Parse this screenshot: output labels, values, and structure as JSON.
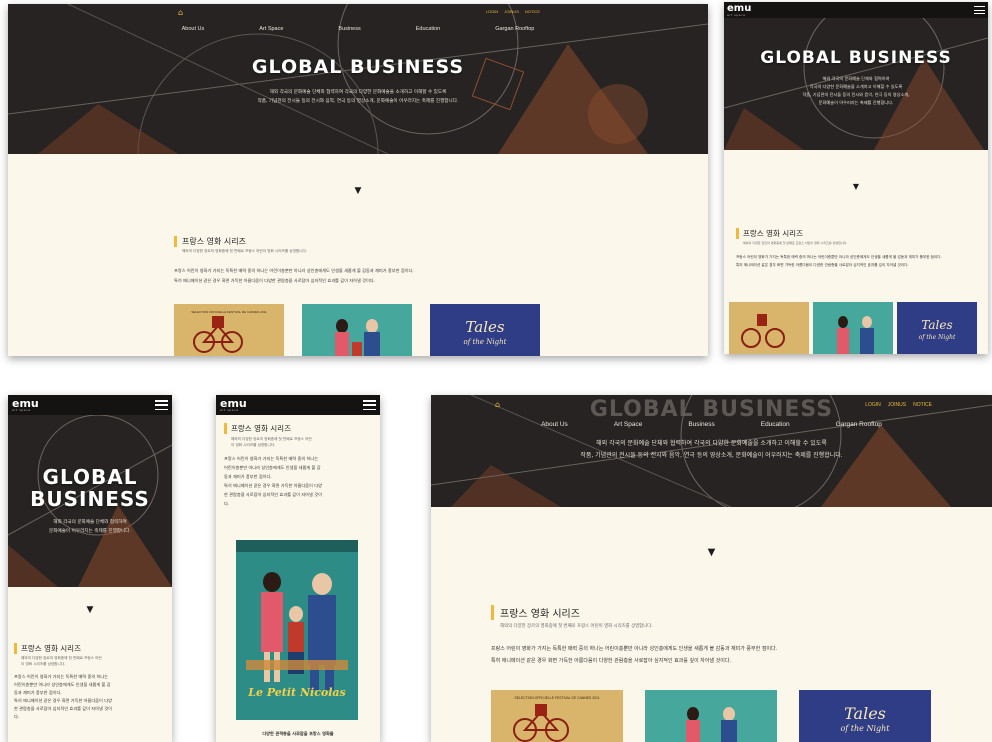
{
  "nav": {
    "items": [
      "About Us",
      "Art Space",
      "Business",
      "Education",
      "Gargan Rooftop"
    ],
    "top_links": [
      "LOGIN",
      "JOINUS",
      "NOTICE"
    ]
  },
  "logo": {
    "text": "emu",
    "sub": "art space"
  },
  "hero": {
    "title": "GLOBAL BUSINESS",
    "title_l1": "GLOBAL",
    "title_l2": "BUSINESS",
    "desc_l1": "해외 각국의 문화예술 단체와 협력하여 각국의 다양한 문화예술을 소개하고 이해할 수 있도록",
    "desc_l2": "작품, 기념관의 전시들 등의 전시와 음악, 연극 등의 영상소개, 문화예술이 어우러지는 축제를 진행합니다.",
    "tablet_l1": "해외 각국의 문화예술 단체와 협력하여",
    "tablet_l2": "각국의 다양한 문화예술을 소개하고 이해할 수 있도록",
    "tablet_l3": "작품, 기념관의 전시들 등의 전시와 음악, 연극 등의 영상소개,",
    "tablet_l4": "문화예술이 어우러지는 축제를 진행합니다.",
    "mobile_l1": "해외 각국의 문화예술 단체와 협력하여",
    "mobile_l2": "문화예술이 어우러지는 축제를 진행합니다."
  },
  "arrow": "▼",
  "section": {
    "title": "프랑스 영화 시리즈",
    "subtitle": "해외의 다양한 장르의 영화중에 첫 번째로 프랑스 어린이 영화 시리즈를 상영합니다.",
    "sub_m1": "해외의 다양한 장르의 영화중에 첫 번째로 프랑스 어린",
    "sub_m2": "이 영화 시리즈를 상영합니다.",
    "body_l1": "프랑스 어린이 영화가 가지는 독특한 매력 중의 하나는 어린이층뿐만 아니라 성인층에게도 인생을 새롭게 볼 감동과 재미가 풍부한 점이다.",
    "body_l2": "특히 애니메이션 같은 경우 화면 가득한 아름다움이 다양한 관람층을 사로잡아 심지적인 효과를 깊이 자아낼 것이다.",
    "m_l1": "프랑스 어린이 영화가 가지는 독특한 매력 중의 하나는",
    "m_l2": "어린이층뿐만 아니라 성인층에게도 인생을 새롭게 볼 감",
    "m_l3": "동과 재미가 풍부한 점이다.",
    "m_l4": "특히 애니메이션 같은 경우 화면 가득한 아름다움이 다양",
    "m_l5": "한 관람층을 사로잡아 심지적인 효과를 깊이 자아낼 것이",
    "m_l6": "다.",
    "caption": "다양한 관객층을 사로잡을 프랑스 영화들"
  },
  "posters": {
    "p1_strip": "SELECTION OFFICIELLE FESTIVAL DE CANNES 2011",
    "p3_title_l1": "Tales",
    "p3_title_l2": "of the Night",
    "p2_title": "Le Petit Nicolas"
  },
  "colors": {
    "accent": "#f0b93d",
    "hero_bg": "#262322",
    "page_bg": "#fbf7ea"
  }
}
